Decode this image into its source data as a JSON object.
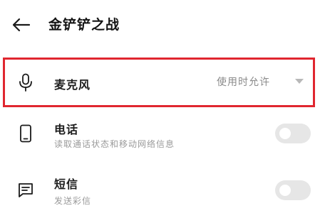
{
  "header": {
    "back_icon": "arrow-left-icon",
    "title": "金铲铲之战"
  },
  "permissions": [
    {
      "icon": "microphone-icon",
      "title": "麦克风",
      "value": "使用时允许",
      "control": "dropdown"
    },
    {
      "icon": "phone-icon",
      "title": "电话",
      "description": "读取通话状态和移动网络信息",
      "control": "toggle",
      "enabled": false
    },
    {
      "icon": "message-icon",
      "title": "短信",
      "description": "发送彩信",
      "control": "toggle",
      "enabled": false
    }
  ],
  "colors": {
    "highlight": "#e0262f",
    "toggle_off": "#e6e6e6"
  }
}
